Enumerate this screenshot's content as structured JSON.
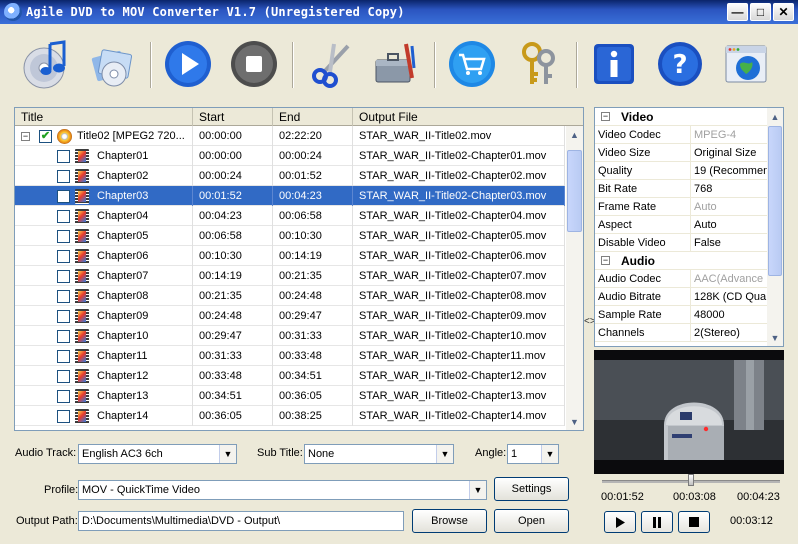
{
  "window": {
    "title": "Agile DVD to MOV Converter V1.7 (Unregistered Copy)"
  },
  "toolbar": {
    "items": [
      {
        "name": "open-dvd-icon"
      },
      {
        "name": "open-folder-icon"
      },
      {
        "name": "play-icon"
      },
      {
        "name": "stop-icon"
      },
      {
        "name": "scissors-icon"
      },
      {
        "name": "toolbox-icon"
      },
      {
        "name": "buy-cart-icon"
      },
      {
        "name": "register-keys-icon"
      },
      {
        "name": "info-icon"
      },
      {
        "name": "help-icon"
      },
      {
        "name": "web-globe-icon"
      }
    ]
  },
  "grid": {
    "columns": {
      "title": "Title",
      "start": "Start",
      "end": "End",
      "output": "Output File"
    },
    "rows": [
      {
        "title": "Title02 [MPEG2 720...",
        "start": "00:00:00",
        "end": "02:22:20",
        "output": "STAR_WAR_II-Title02.mov",
        "kind": "title",
        "checked": true
      },
      {
        "title": "Chapter01",
        "start": "00:00:00",
        "end": "00:00:24",
        "output": "STAR_WAR_II-Title02-Chapter01.mov",
        "kind": "chapter"
      },
      {
        "title": "Chapter02",
        "start": "00:00:24",
        "end": "00:01:52",
        "output": "STAR_WAR_II-Title02-Chapter02.mov",
        "kind": "chapter"
      },
      {
        "title": "Chapter03",
        "start": "00:01:52",
        "end": "00:04:23",
        "output": "STAR_WAR_II-Title02-Chapter03.mov",
        "kind": "chapter",
        "selected": true
      },
      {
        "title": "Chapter04",
        "start": "00:04:23",
        "end": "00:06:58",
        "output": "STAR_WAR_II-Title02-Chapter04.mov",
        "kind": "chapter"
      },
      {
        "title": "Chapter05",
        "start": "00:06:58",
        "end": "00:10:30",
        "output": "STAR_WAR_II-Title02-Chapter05.mov",
        "kind": "chapter"
      },
      {
        "title": "Chapter06",
        "start": "00:10:30",
        "end": "00:14:19",
        "output": "STAR_WAR_II-Title02-Chapter06.mov",
        "kind": "chapter"
      },
      {
        "title": "Chapter07",
        "start": "00:14:19",
        "end": "00:21:35",
        "output": "STAR_WAR_II-Title02-Chapter07.mov",
        "kind": "chapter"
      },
      {
        "title": "Chapter08",
        "start": "00:21:35",
        "end": "00:24:48",
        "output": "STAR_WAR_II-Title02-Chapter08.mov",
        "kind": "chapter"
      },
      {
        "title": "Chapter09",
        "start": "00:24:48",
        "end": "00:29:47",
        "output": "STAR_WAR_II-Title02-Chapter09.mov",
        "kind": "chapter"
      },
      {
        "title": "Chapter10",
        "start": "00:29:47",
        "end": "00:31:33",
        "output": "STAR_WAR_II-Title02-Chapter10.mov",
        "kind": "chapter"
      },
      {
        "title": "Chapter11",
        "start": "00:31:33",
        "end": "00:33:48",
        "output": "STAR_WAR_II-Title02-Chapter11.mov",
        "kind": "chapter"
      },
      {
        "title": "Chapter12",
        "start": "00:33:48",
        "end": "00:34:51",
        "output": "STAR_WAR_II-Title02-Chapter12.mov",
        "kind": "chapter"
      },
      {
        "title": "Chapter13",
        "start": "00:34:51",
        "end": "00:36:05",
        "output": "STAR_WAR_II-Title02-Chapter13.mov",
        "kind": "chapter"
      },
      {
        "title": "Chapter14",
        "start": "00:36:05",
        "end": "00:38:25",
        "output": "STAR_WAR_II-Title02-Chapter14.mov",
        "kind": "chapter"
      }
    ]
  },
  "properties": {
    "video_group": "Video",
    "video": [
      {
        "key": "Video Codec",
        "value": "MPEG-4",
        "dim": true
      },
      {
        "key": "Video Size",
        "value": "Original Size"
      },
      {
        "key": "Quality",
        "value": "19 (Recommen"
      },
      {
        "key": "Bit Rate",
        "value": "768"
      },
      {
        "key": "Frame Rate",
        "value": "Auto",
        "dim": true
      },
      {
        "key": "Aspect",
        "value": "Auto"
      },
      {
        "key": "Disable Video",
        "value": "False"
      }
    ],
    "audio_group": "Audio",
    "audio": [
      {
        "key": "Audio Codec",
        "value": "AAC(Advance",
        "dim": true
      },
      {
        "key": "Audio Bitrate",
        "value": "128K (CD Qua"
      },
      {
        "key": "Sample Rate",
        "value": "48000"
      },
      {
        "key": "Channels",
        "value": "2(Stereo)"
      }
    ]
  },
  "player": {
    "start_time": "00:01:52",
    "current_time": "00:03:08",
    "end_time": "00:04:23",
    "elapsed": "00:03:12",
    "position_fraction": 0.5
  },
  "controls": {
    "audio_track_label": "Audio Track:",
    "audio_track_value": "English AC3 6ch",
    "subtitle_label": "Sub Title:",
    "subtitle_value": "None",
    "angle_label": "Angle:",
    "angle_value": "1",
    "profile_label": "Profile:",
    "profile_value": "MOV - QuickTime Video",
    "settings_button": "Settings",
    "output_path_label": "Output Path:",
    "output_path_value": "D:\\Documents\\Multimedia\\DVD - Output\\",
    "browse_button": "Browse",
    "open_button": "Open"
  },
  "colors": {
    "selection": "#316ac5",
    "window_bg": "#ece9d8",
    "titlebar": "#2b55c0"
  }
}
